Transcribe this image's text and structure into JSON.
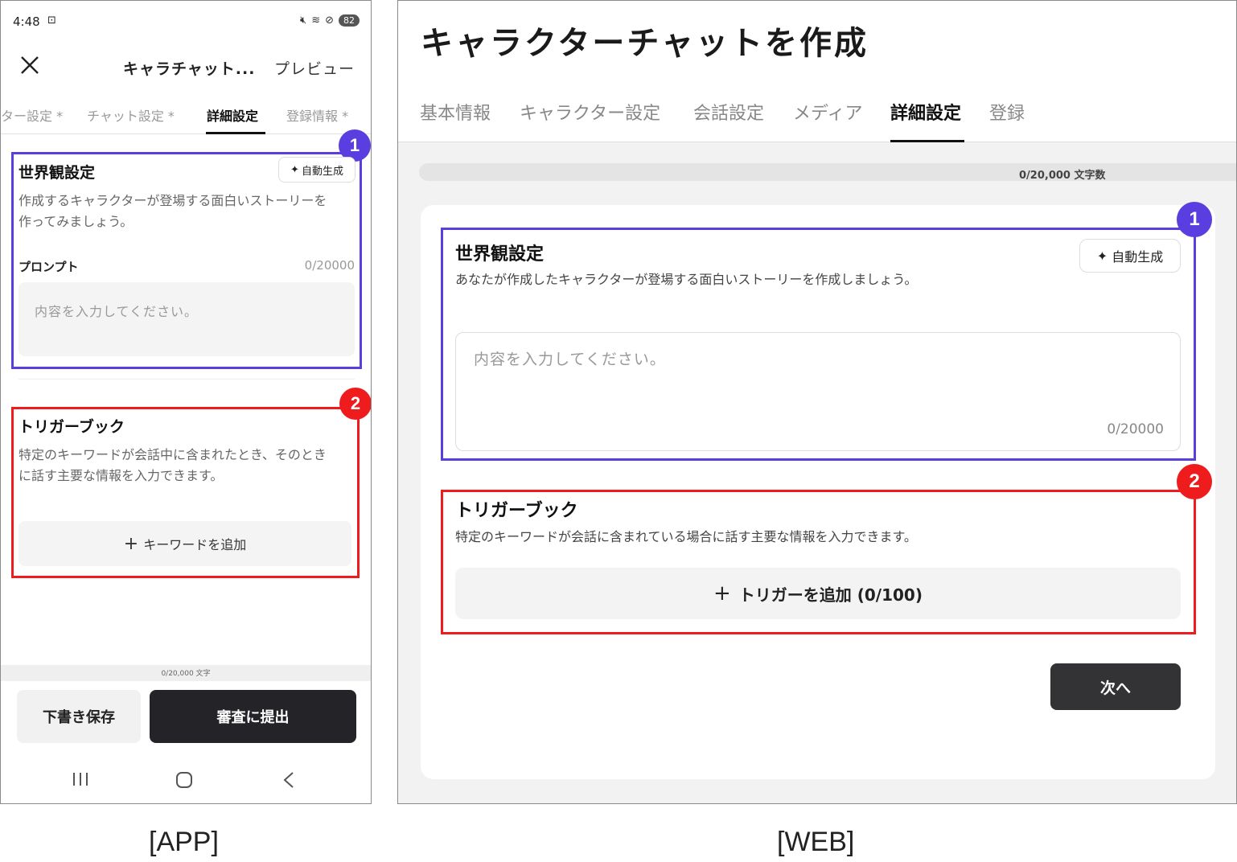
{
  "app": {
    "status": {
      "time": "4:48",
      "battery": "82"
    },
    "title": "キャラチャット...",
    "preview": "プレビュー",
    "tabs": [
      {
        "label": "ター設定 *"
      },
      {
        "label": "チャット設定 *"
      },
      {
        "label": "詳細設定",
        "active": true
      },
      {
        "label": "登録情報 *"
      }
    ],
    "world": {
      "badge": "1",
      "title": "世界観設定",
      "auto_label": "自動生成",
      "desc_line1": "作成するキャラクターが登場する面白いストーリーを",
      "desc_line2": "作ってみましょう。",
      "prompt_label": "プロンプト",
      "prompt_count": "0/20000",
      "placeholder": "内容を入力してください。"
    },
    "trigger": {
      "badge": "2",
      "title": "トリガーブック",
      "desc_line1": "特定のキーワードが会話中に含まれたとき、そのとき",
      "desc_line2": "に話す主要な情報を入力できます。",
      "add_label": "キーワードを追加"
    },
    "char_count": "0/20,000 文字",
    "draft_label": "下書き保存",
    "submit_label": "審査に提出"
  },
  "web": {
    "title": "キャラクターチャットを作成",
    "tabs": [
      {
        "label": "基本情報"
      },
      {
        "label": "キャラクター設定"
      },
      {
        "label": "会話設定"
      },
      {
        "label": "メディア"
      },
      {
        "label": "詳細設定",
        "active": true
      },
      {
        "label": "登録"
      }
    ],
    "char_count": "0/20,000 文字数",
    "world": {
      "badge": "1",
      "title": "世界観設定",
      "desc": "あなたが作成したキャラクターが登場する面白いストーリーを作成しましょう。",
      "auto_label": "自動生成",
      "placeholder": "内容を入力してください。",
      "count": "0/20000"
    },
    "trigger": {
      "badge": "2",
      "title": "トリガーブック",
      "desc": "特定のキーワードが会話に含まれている場合に話す主要な情報を入力できます。",
      "add_label": "トリガーを追加 (0/100)"
    },
    "next_label": "次へ"
  },
  "captions": {
    "app": "[APP]",
    "web": "[WEB]"
  },
  "colors": {
    "highlight_blue": "#5a3ee0",
    "highlight_red": "#ee1c1c",
    "primary_button": "#242428"
  }
}
